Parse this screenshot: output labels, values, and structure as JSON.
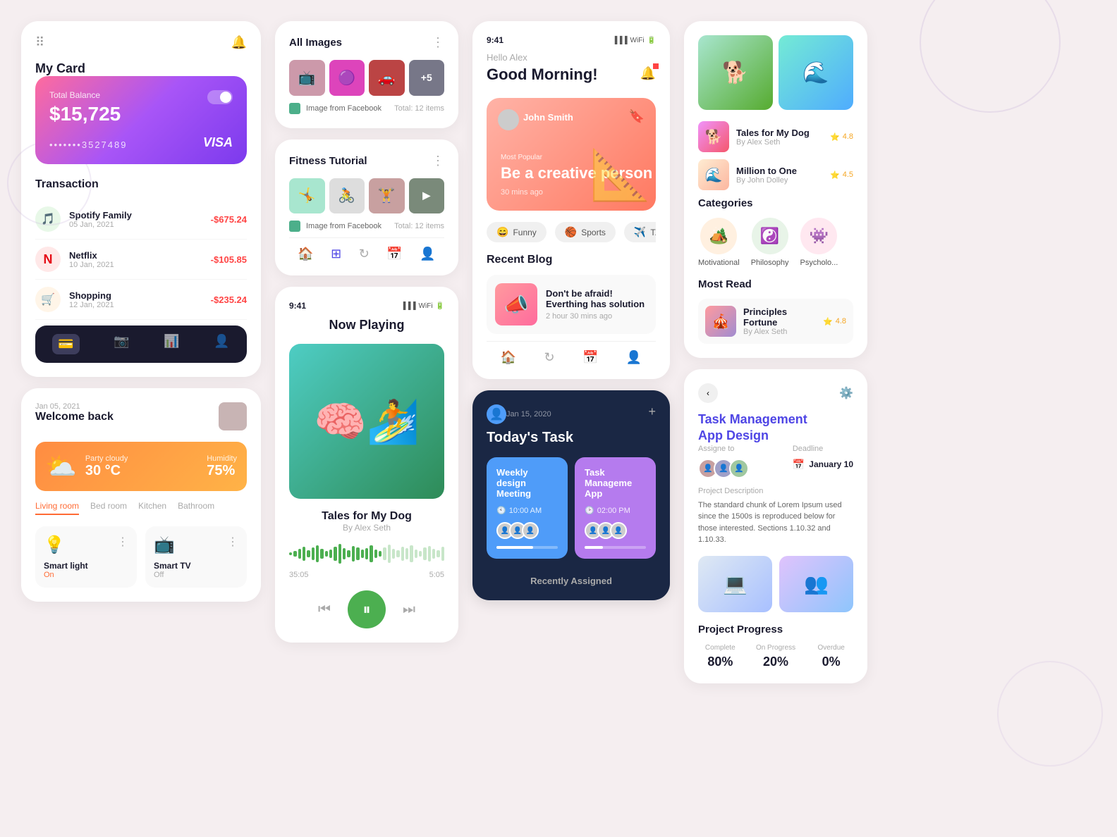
{
  "col1": {
    "title": "My Card",
    "balance_label": "Total Balance",
    "balance_amount": "$15,725",
    "card_number": "•••••••3527489",
    "card_brand": "VISA",
    "transactions": {
      "title": "Transaction",
      "items": [
        {
          "name": "Spotify Family",
          "date": "05 Jan, 2021",
          "amount": "-$675.24",
          "icon": "🎵",
          "color": "#e8f8e8"
        },
        {
          "name": "Netflix",
          "date": "10 Jan, 2021",
          "amount": "-$105.85",
          "icon": "N",
          "color": "#ffe8e8"
        },
        {
          "name": "Shopping",
          "date": "12 Jan, 2021",
          "amount": "-$235.24",
          "icon": "🛒",
          "color": "#fff5e8"
        }
      ]
    }
  },
  "col1_welcome": {
    "date": "Jan 05, 2021",
    "title": "Welcome back",
    "weather": {
      "icon": "⛅",
      "description": "Party cloudy",
      "temperature": "30 °C",
      "humidity_label": "Humidity",
      "humidity": "75%"
    },
    "rooms": [
      "Living room",
      "Bed room",
      "Kitchen",
      "Bathroom"
    ],
    "active_room": "Living room",
    "devices": [
      {
        "icon": "💡",
        "name": "Smart light",
        "status": "On",
        "active": true
      },
      {
        "icon": "📺",
        "name": "Smart TV",
        "status": "Off",
        "active": false
      }
    ]
  },
  "col2_images": {
    "title": "All Images",
    "source": "Image from Facebook",
    "total": "Total: 12 items",
    "thumbs": [
      "📺",
      "🟣",
      "🚗",
      "➕"
    ]
  },
  "col2_fitness": {
    "title": "Fitness Tutorial",
    "source": "Image from Facebook",
    "total": "Total: 12 items"
  },
  "col2_music": {
    "status_time": "9:41",
    "now_playing": "Now Playing",
    "track_name": "Tales for My Dog",
    "track_artist": "By Alex Seth",
    "time_current": "35:05",
    "time_total": "5:05",
    "waveform_bars": [
      4,
      8,
      14,
      20,
      10,
      18,
      24,
      14,
      8,
      12,
      20,
      28,
      16,
      10,
      22,
      18,
      12,
      16,
      24,
      12,
      8,
      18,
      26,
      14,
      10,
      20,
      16,
      24,
      12,
      8,
      18,
      22,
      14,
      10,
      20
    ]
  },
  "col3_blog": {
    "greeting": "Hello Alex",
    "morning": "Good Morning!",
    "hero": {
      "person": "John Smith",
      "tag": "Most Popular",
      "title": "Be a creative person",
      "time": "30 mins ago"
    },
    "categories": [
      "Funny",
      "Sports",
      "T..."
    ],
    "recent_title": "Recent Blog",
    "post": {
      "title": "Don't be afraid! Everthing has solution",
      "time": "2 hour 30 mins ago"
    }
  },
  "col3_task": {
    "date": "Jan 15, 2020",
    "title": "Today's Task",
    "tasks": [
      {
        "title": "Weekly design Meeting",
        "time": "10:00 AM",
        "progress": 60
      },
      {
        "title": "Task Manageme App",
        "time": "02:00 PM",
        "progress": 30
      }
    ],
    "recently_label": "Recently Assigned"
  },
  "col4_books": {
    "items": [
      {
        "title": "Tales for My Dog",
        "author": "By Alex Seth",
        "rating": "4.8"
      },
      {
        "title": "Million to One",
        "author": "By John Dolley",
        "rating": "4.5"
      }
    ],
    "categories_title": "Categories",
    "categories": [
      {
        "name": "Motivational",
        "icon": "🏕️"
      },
      {
        "name": "Philosophy",
        "icon": "☯️"
      },
      {
        "name": "Psycholo...",
        "icon": "👾"
      }
    ],
    "most_read_title": "Most Read",
    "most_read": {
      "title": "Principles Fortune",
      "author": "By Alex Seth",
      "rating": "4.8"
    }
  },
  "col4_taskm": {
    "title": "Task Management\nApp Design",
    "assign_label": "Assigne to",
    "deadline_label": "Deadline",
    "deadline": "January 10",
    "desc_label": "Project Description",
    "desc": "The standard chunk of Lorem Ipsum used since the 1500s is reproduced below for those interested. Sections 1.10.32 and 1.10.33.",
    "progress_label": "Project Progress",
    "stats": [
      {
        "label": "Complete",
        "value": "80%"
      },
      {
        "label": "On Progress",
        "value": "20%"
      },
      {
        "label": "Overdue",
        "value": "0%"
      }
    ]
  }
}
